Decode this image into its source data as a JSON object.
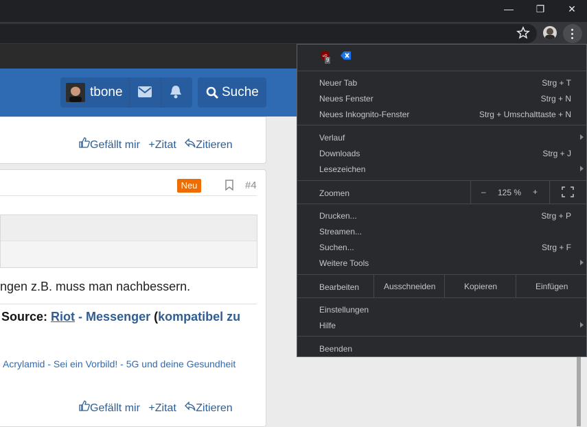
{
  "browser": {
    "window_controls": {
      "minimize": "—",
      "restore": "❐",
      "close": "✕"
    },
    "icons": [
      "star-icon",
      "profile-avatar",
      "kebab-menu-icon"
    ]
  },
  "forum": {
    "user": {
      "name": "tbone"
    },
    "search_label": "Suche",
    "post1_actions": {
      "like": "Gefällt mir",
      "quote": "Zitat",
      "reply": "Zitieren"
    },
    "post2": {
      "badge": "Neu",
      "number": "#4",
      "text": "ngen z.B. muss man nachbessern.",
      "signature": {
        "source": "Source:",
        "riot": "Riot",
        "dash": " - ",
        "messenger": "Messenger",
        "paren": " (",
        "compat": "kompatibel zu"
      },
      "links": "Acrylamid - Sei ein Vorbild! - 5G und deine Gesundheit"
    },
    "post2_actions": {
      "like": "Gefällt mir",
      "quote": "Zitat",
      "reply": "Zitieren"
    }
  },
  "menu": {
    "extension_badge": "9",
    "items": {
      "new_tab": "Neuer Tab",
      "new_tab_sc": "Strg + T",
      "new_window": "Neues Fenster",
      "new_window_sc": "Strg + N",
      "incognito": "Neues Inkognito-Fenster",
      "incognito_sc": "Strg + Umschalttaste + N",
      "history": "Verlauf",
      "downloads": "Downloads",
      "downloads_sc": "Strg + J",
      "bookmarks": "Lesezeichen",
      "zoom": "Zoomen",
      "zoom_minus": "–",
      "zoom_value": "125 %",
      "zoom_plus": "+",
      "print": "Drucken...",
      "print_sc": "Strg + P",
      "cast": "Streamen...",
      "find": "Suchen...",
      "find_sc": "Strg + F",
      "more_tools": "Weitere Tools",
      "edit": "Bearbeiten",
      "cut": "Ausschneiden",
      "copy": "Kopieren",
      "paste": "Einfügen",
      "settings": "Einstellungen",
      "help": "Hilfe",
      "exit": "Beenden"
    }
  }
}
